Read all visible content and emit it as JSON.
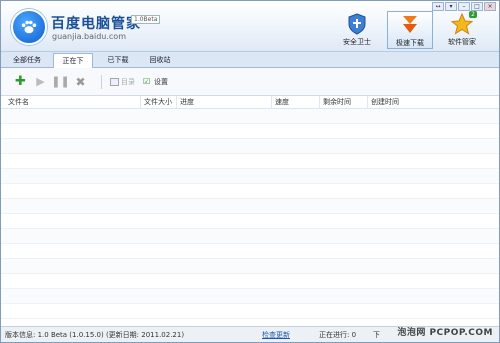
{
  "header": {
    "brand_title": "百度电脑管家",
    "brand_version": "1.0Beta",
    "brand_url": "guanjia.baidu.com",
    "window_buttons": [
      "↔",
      "▾",
      "–",
      "□",
      "×"
    ],
    "nav": [
      {
        "label": "安全卫士",
        "icon": "shield-icon"
      },
      {
        "label": "极速下载",
        "icon": "download-arrow-icon"
      },
      {
        "label": "软件管家",
        "icon": "star-icon",
        "badge": "2"
      }
    ]
  },
  "tabs": [
    {
      "label": "全部任务",
      "active": false
    },
    {
      "label": "正在下载",
      "active": true
    },
    {
      "label": "已下载",
      "active": false
    },
    {
      "label": "回收站",
      "active": false
    }
  ],
  "toolbar": {
    "dir_label": "目录",
    "settings_label": "设置"
  },
  "table": {
    "columns": [
      "文件名",
      "文件大小",
      "进度",
      "速度",
      "剩余时间",
      "创建时间"
    ]
  },
  "status": {
    "version_info": "版本信息: 1.0 Beta (1.0.15.0) (更新日期: 2011.02.21)",
    "check_update": "检查更新",
    "running": "正在进行: 0",
    "more": "下"
  },
  "watermark": "泡泡网 PCPOP.COM",
  "colors": {
    "accent": "#1a4f98",
    "tab_bg": "#dbe7f4",
    "add_green": "#2e9a2e",
    "download_orange": "#f07a18"
  }
}
